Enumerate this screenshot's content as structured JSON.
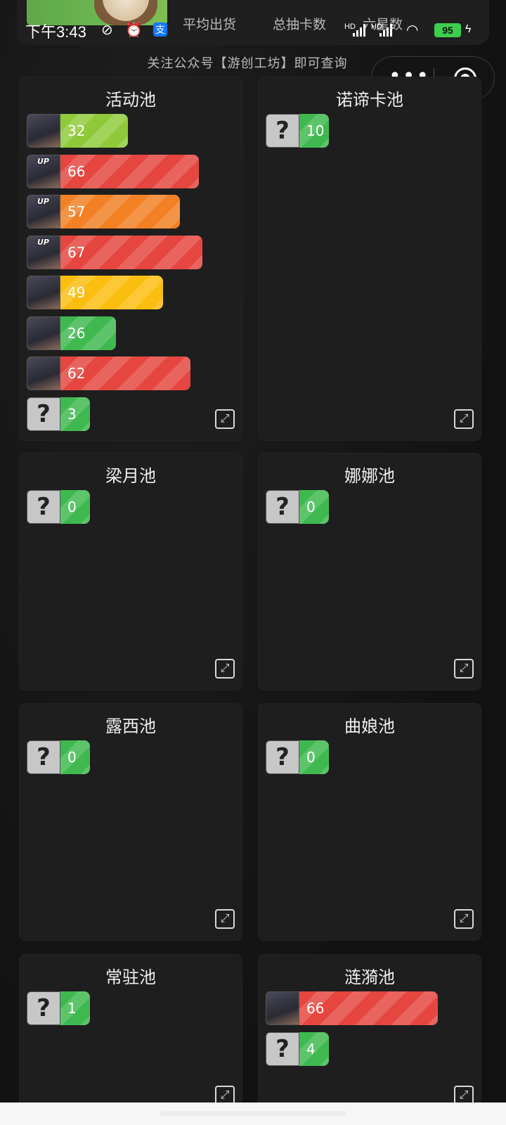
{
  "status": {
    "time": "下午3:43",
    "battery": "95",
    "network_label": "HD"
  },
  "header": {
    "stats": [
      {
        "label": "平均出货"
      },
      {
        "label": "总抽卡数"
      },
      {
        "label": "六星数"
      }
    ]
  },
  "notice": "关注公众号【游创工坊】即可查询",
  "capsule": {
    "more_icon": "more-dots-icon",
    "close_icon": "target-close-icon"
  },
  "pools": [
    {
      "title": "活动池",
      "rows": [
        {
          "type": "img",
          "up": false,
          "value": "32",
          "color": "#8fc93a",
          "fraction": 0.4
        },
        {
          "type": "img",
          "up": true,
          "value": "66",
          "color": "#e5463f",
          "fraction": 0.82
        },
        {
          "type": "img",
          "up": true,
          "value": "57",
          "color": "#f28024",
          "fraction": 0.71
        },
        {
          "type": "img",
          "up": true,
          "value": "67",
          "color": "#e5463f",
          "fraction": 0.84
        },
        {
          "type": "img",
          "up": false,
          "value": "49",
          "color": "#fbbd0f",
          "fraction": 0.61
        },
        {
          "type": "img",
          "up": false,
          "value": "26",
          "color": "#3fb94f",
          "fraction": 0.33
        },
        {
          "type": "img",
          "up": false,
          "value": "62",
          "color": "#e5463f",
          "fraction": 0.77
        },
        {
          "type": "q",
          "up": false,
          "value": "3",
          "color": "#3fb94f",
          "fraction": 0.15
        }
      ]
    },
    {
      "title": "诺谛卡池",
      "rows": [
        {
          "type": "q",
          "up": false,
          "value": "10",
          "color": "#3fb94f",
          "fraction": 0.15
        }
      ]
    },
    {
      "title": "梁月池",
      "rows": [
        {
          "type": "q",
          "up": false,
          "value": "0",
          "color": "#3fb94f",
          "fraction": 0.15
        }
      ]
    },
    {
      "title": "娜娜池",
      "rows": [
        {
          "type": "q",
          "up": false,
          "value": "0",
          "color": "#3fb94f",
          "fraction": 0.15
        }
      ]
    },
    {
      "title": "露西池",
      "rows": [
        {
          "type": "q",
          "up": false,
          "value": "0",
          "color": "#3fb94f",
          "fraction": 0.15
        }
      ]
    },
    {
      "title": "曲娘池",
      "rows": [
        {
          "type": "q",
          "up": false,
          "value": "0",
          "color": "#3fb94f",
          "fraction": 0.15
        }
      ]
    },
    {
      "title": "常驻池",
      "rows": [
        {
          "type": "q",
          "up": false,
          "value": "1",
          "color": "#3fb94f",
          "fraction": 0.15
        }
      ]
    },
    {
      "title": "涟漪池",
      "rows": [
        {
          "type": "img",
          "up": false,
          "value": "66",
          "color": "#e5463f",
          "fraction": 0.82
        },
        {
          "type": "q",
          "up": false,
          "value": "4",
          "color": "#3fb94f",
          "fraction": 0.15
        }
      ]
    }
  ]
}
